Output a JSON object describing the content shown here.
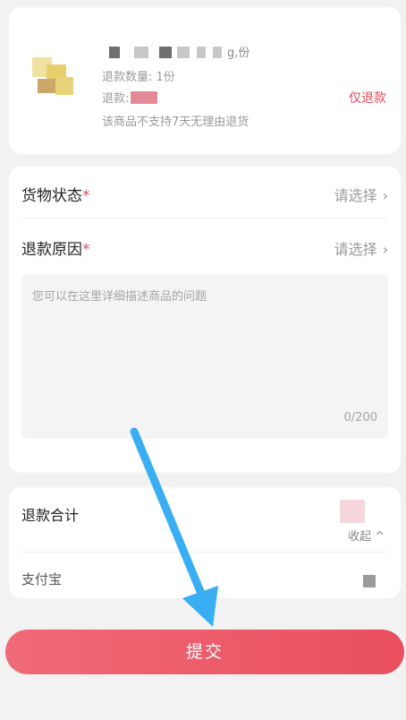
{
  "product": {
    "name_suffix": "g,份",
    "quantity_text": "退款数量: 1份",
    "amount_label": "退款:",
    "policy_text": "该商品不支持7天无理由退货",
    "refund_type": "仅退款"
  },
  "form": {
    "goods_status": {
      "label": "货物状态",
      "required_mark": "*",
      "value": "请选择",
      "chevron": "›"
    },
    "refund_reason": {
      "label": "退款原因",
      "required_mark": "*",
      "value": "请选择",
      "chevron": "›"
    },
    "description": {
      "placeholder": "您可以在这里详细描述商品的问题",
      "counter": "0/200"
    }
  },
  "summary": {
    "total_label": "退款合计",
    "collapse_label": "收起",
    "collapse_icon": "chevron-up-icon",
    "payment_method": "支付宝"
  },
  "submit": {
    "label": "提交"
  },
  "colors": {
    "accent": "#e14b5c",
    "button_start": "#f06a78",
    "button_end": "#ea4f5e",
    "annotation_arrow": "#39aef2"
  }
}
